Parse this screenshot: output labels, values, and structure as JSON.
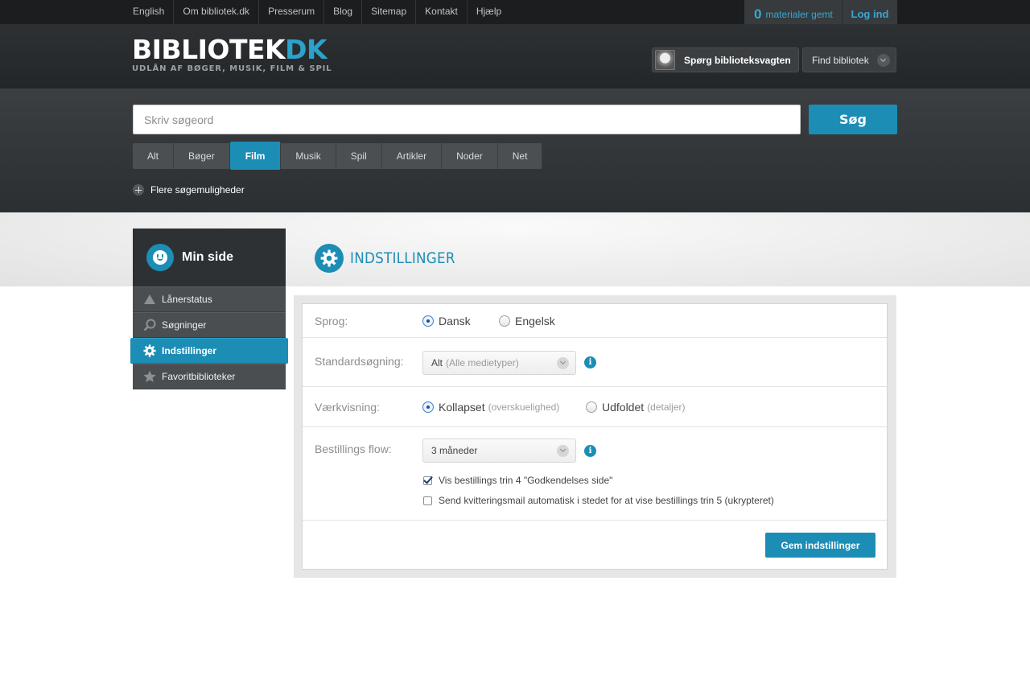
{
  "topnav": {
    "links": [
      "English",
      "Om bibliotek.dk",
      "Presserum",
      "Blog",
      "Sitemap",
      "Kontakt",
      "Hjælp"
    ],
    "saved_count": "0",
    "saved_label": "materialer gemt",
    "login_label": "Log ind"
  },
  "header": {
    "logo_main": "BIBLIOTEK",
    "logo_dk": "DK",
    "logo_tagline": "UDLÅN AF BØGER, MUSIK, FILM & SPIL",
    "ask_label": "Spørg biblioteksvagten",
    "find_library_label": "Find bibliotek"
  },
  "search": {
    "placeholder": "Skriv søgeord",
    "button_label": "Søg",
    "tabs": [
      "Alt",
      "Bøger",
      "Film",
      "Musik",
      "Spil",
      "Artikler",
      "Noder",
      "Net"
    ],
    "active_tab": "Film",
    "more_options_label": "Flere søgemuligheder"
  },
  "sidebar": {
    "title": "Min side",
    "items": [
      {
        "label": "Lånerstatus",
        "icon": "triangle-icon"
      },
      {
        "label": "Søgninger",
        "icon": "magnifier-icon"
      },
      {
        "label": "Indstillinger",
        "icon": "gear-icon",
        "active": true
      },
      {
        "label": "Favoritbiblioteker",
        "icon": "star-icon"
      }
    ]
  },
  "main": {
    "title": "INDSTILLINGER",
    "language": {
      "label": "Sprog:",
      "options": [
        "Dansk",
        "Engelsk"
      ],
      "selected": "Dansk"
    },
    "default_search": {
      "label": "Standardsøgning:",
      "value": "Alt",
      "value_hint": "(Alle medietyper)"
    },
    "work_view": {
      "label": "Værkvisning:",
      "options": [
        {
          "label": "Kollapset",
          "hint": "(overskuelighed)"
        },
        {
          "label": "Udfoldet",
          "hint": "(detaljer)"
        }
      ],
      "selected": "Kollapset"
    },
    "order_flow": {
      "label": "Bestillings flow:",
      "value": "3 måneder",
      "checkboxes": [
        {
          "label": "Vis bestillings trin 4 \"Godkendelses side\"",
          "checked": true
        },
        {
          "label": "Send kvitteringsmail automatisk i stedet for at vise bestillings trin 5 (ukrypteret)",
          "checked": false
        }
      ]
    },
    "info_glyph": "i",
    "save_label": "Gem indstillinger"
  },
  "colors": {
    "accent": "#1c8db5",
    "topbar": "#1b1d1f",
    "header": "#2a2d30"
  }
}
